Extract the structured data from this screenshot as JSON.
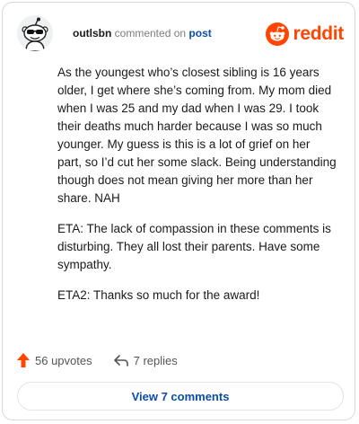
{
  "header": {
    "username": "outlsbn",
    "verb": "commented on",
    "post_link": "post",
    "brand": "reddit"
  },
  "comment": {
    "paragraphs": [
      "As the youngest who’s closest sibling is 16 years older, I get where she’s coming from. My mom died when I was 25 and my dad when I was 29. I took their deaths much harder because I was so much younger. My guess is this is a lot of grief on her part, so I’d cut her some slack. Being understanding though does not mean giving her more than her share. NAH",
      "ETA: The lack of compassion in these comments is disturbing. They all lost their parents. Have some sympathy.",
      "ETA2: Thanks so much for the award!"
    ]
  },
  "actions": {
    "upvotes_label": "56 upvotes",
    "replies_label": "7 replies"
  },
  "view_button": "View 7 comments",
  "colors": {
    "brand": "#ff4500",
    "link": "#0a4ea8",
    "border": "#d7d9dc"
  },
  "icons": {
    "upvote": "arrow-up-icon",
    "reply": "reply-arrow-icon",
    "brand": "reddit-snoo-icon",
    "avatar": "snoo-avatar"
  }
}
